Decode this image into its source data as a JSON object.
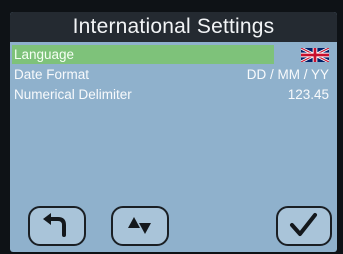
{
  "title": "International Settings",
  "settings": [
    {
      "label": "Language",
      "value_icon": "uk-flag-icon",
      "selected": true
    },
    {
      "label": "Date Format",
      "value": "DD / MM / YY"
    },
    {
      "label": "Numerical Delimiter",
      "value": "123.45"
    }
  ],
  "buttons": {
    "back": {
      "icon": "back-arrow-icon"
    },
    "sort": {
      "icon": "up-down-arrows-icon"
    },
    "confirm": {
      "icon": "checkmark-icon"
    }
  },
  "colors": {
    "screen_bg": "#8fb1cc",
    "title_bg": "#242a31",
    "selection_bg": "#7ec27a",
    "button_bg": "#a9c4d9"
  }
}
